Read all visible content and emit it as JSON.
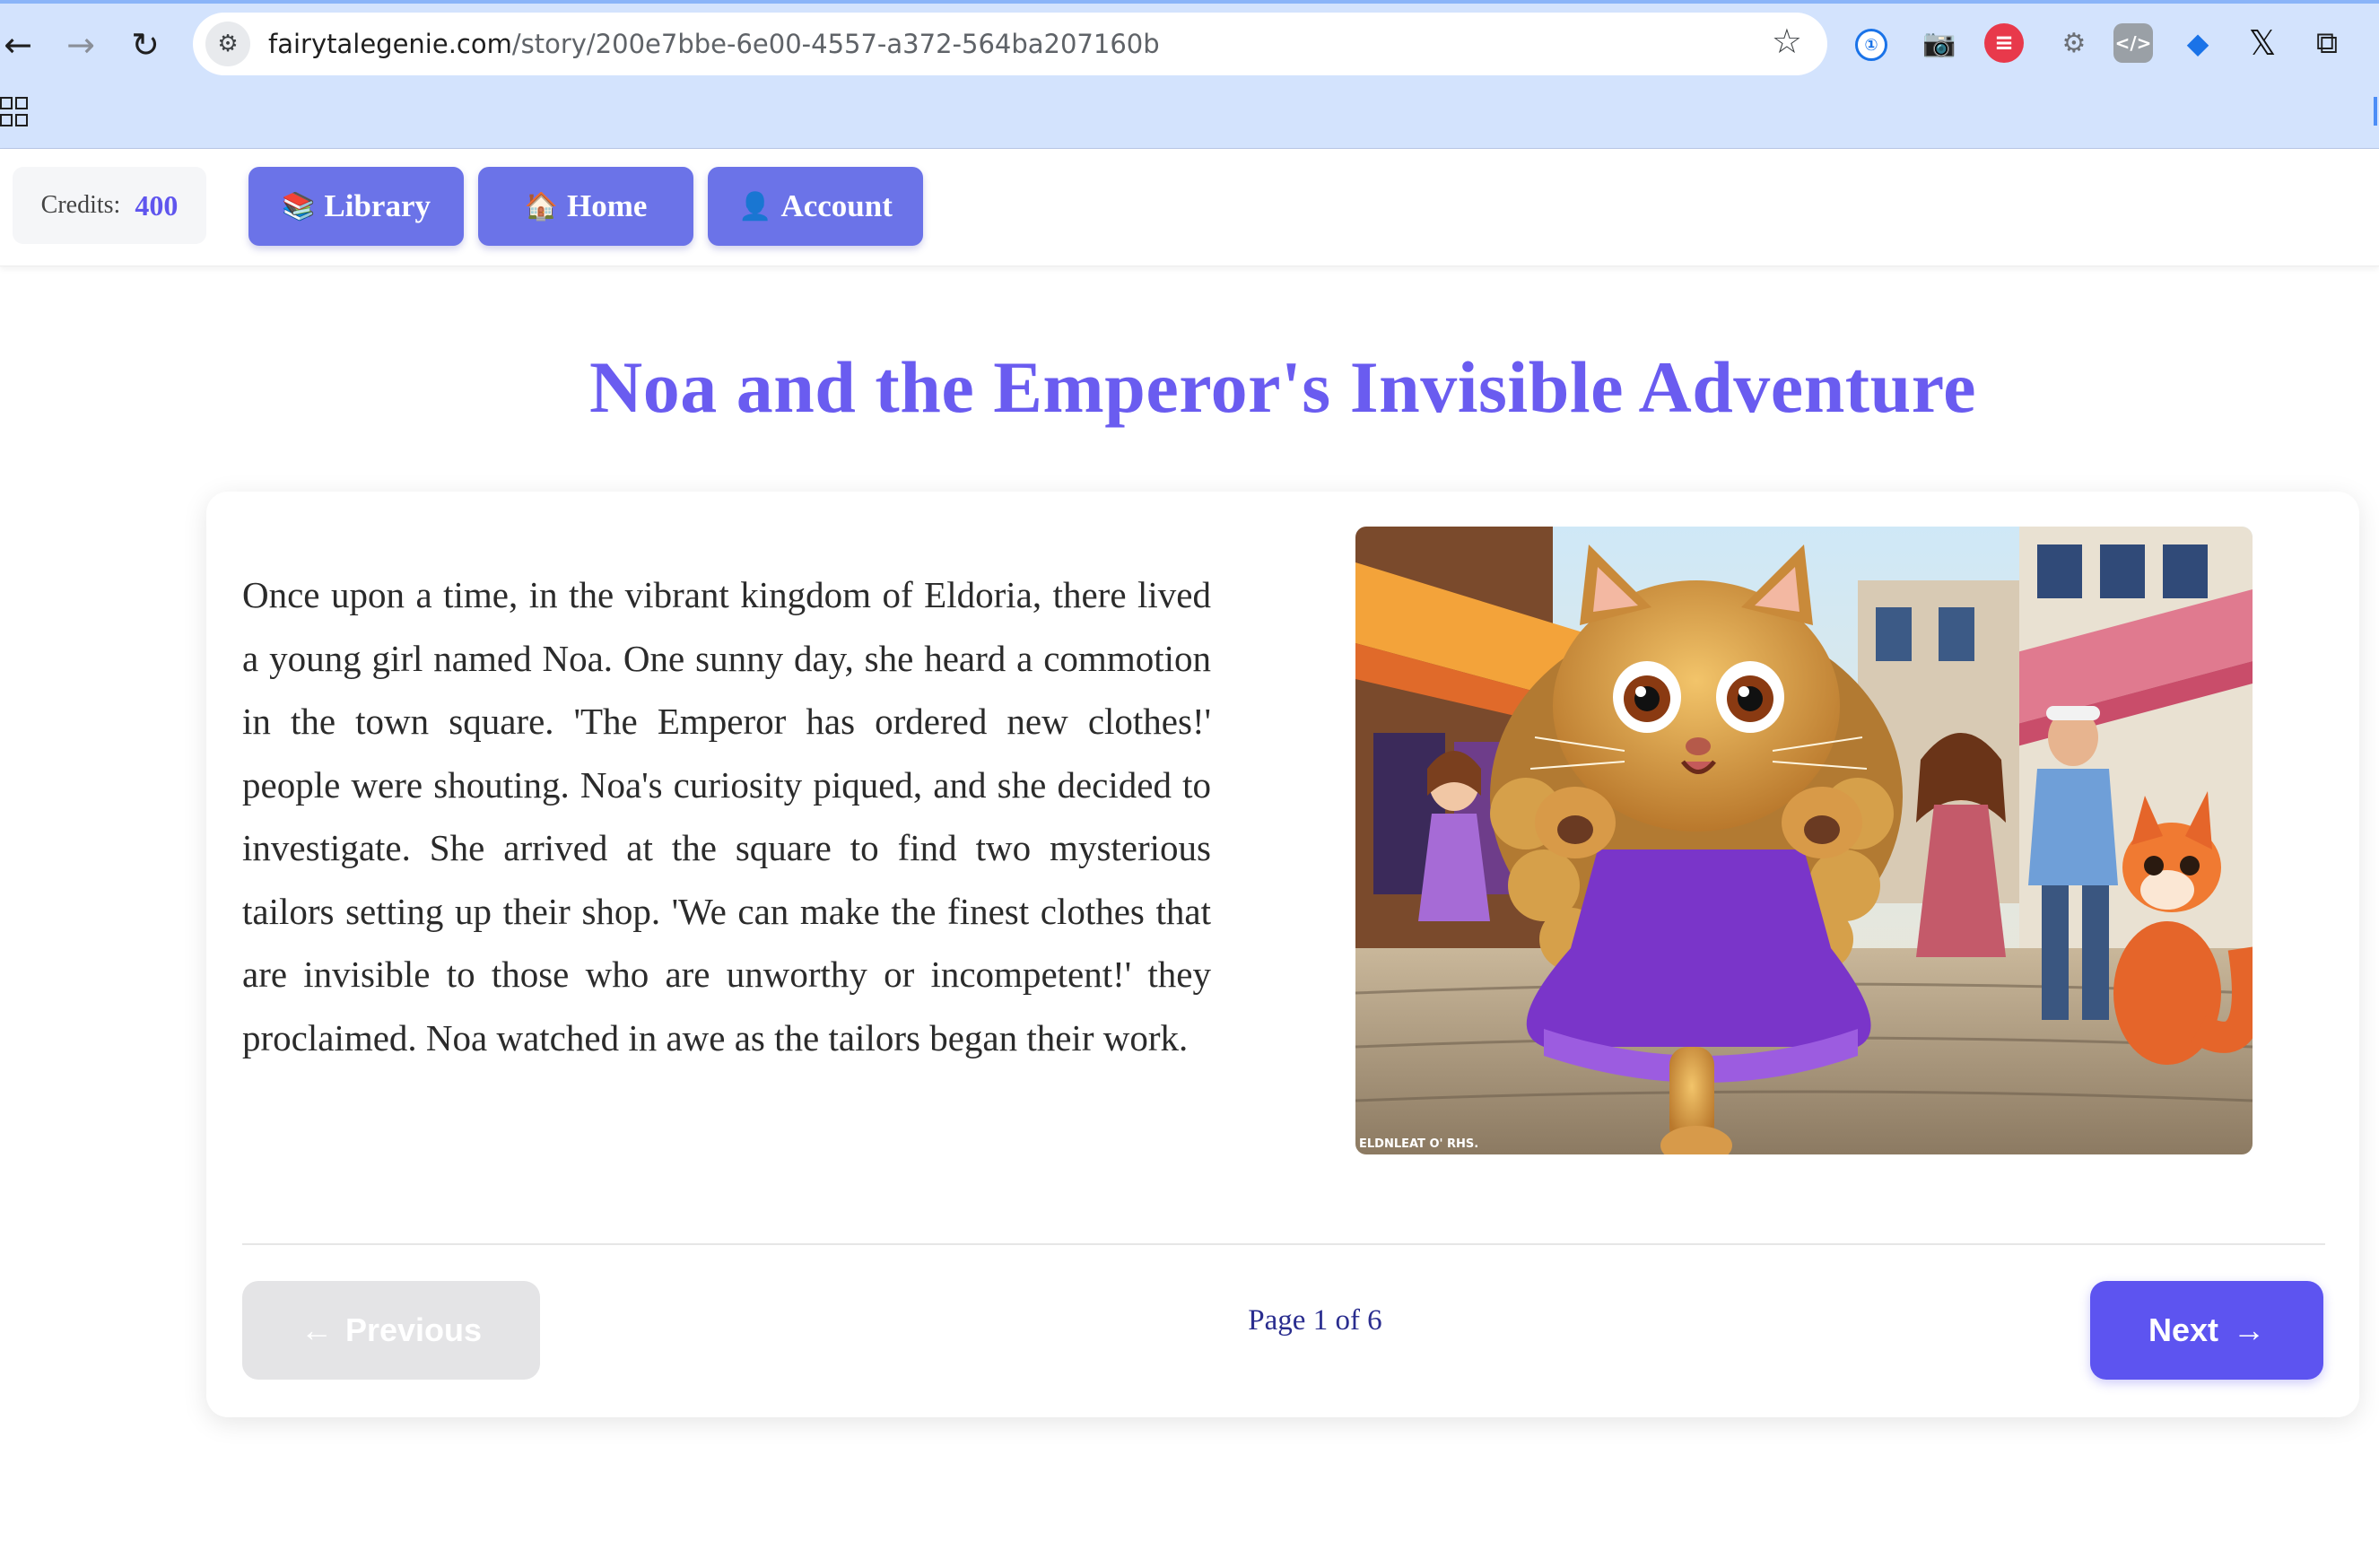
{
  "browser": {
    "url_domain": "fairytalegenie.com",
    "url_path": "/story/200e7bbe-6e00-4557-a372-564ba207160b"
  },
  "nav": {
    "credits_label": "Credits:",
    "credits_value": "400",
    "library_label": "Library",
    "home_label": "Home",
    "account_label": "Account"
  },
  "story": {
    "title": "Noa and the Emperor's Invisible Adventure",
    "text": "Once upon a time, in the vibrant kingdom of Eldoria, there lived a young girl named Noa. One sunny day, she heard a commotion in the town square. 'The Emperor has ordered new clothes!' people were shouting. Noa's curiosity piqued, and she decided to investigate. She arrived at the square to find two mysterious tailors setting up their shop. 'We can make the finest clothes that are invisible to those who are unworthy or incompetent!' they proclaimed. Noa watched in awe as the tailors began their work.",
    "image_caption": "ELDNLEAT O' RHS."
  },
  "pager": {
    "previous_label": "Previous",
    "next_label": "Next",
    "page_text": "Page 1 of 6"
  },
  "colors": {
    "accent": "#6a5cf0",
    "nav_button": "#6b73e8",
    "next_button": "#5d54f0",
    "disabled_button": "#e4e4e6"
  }
}
